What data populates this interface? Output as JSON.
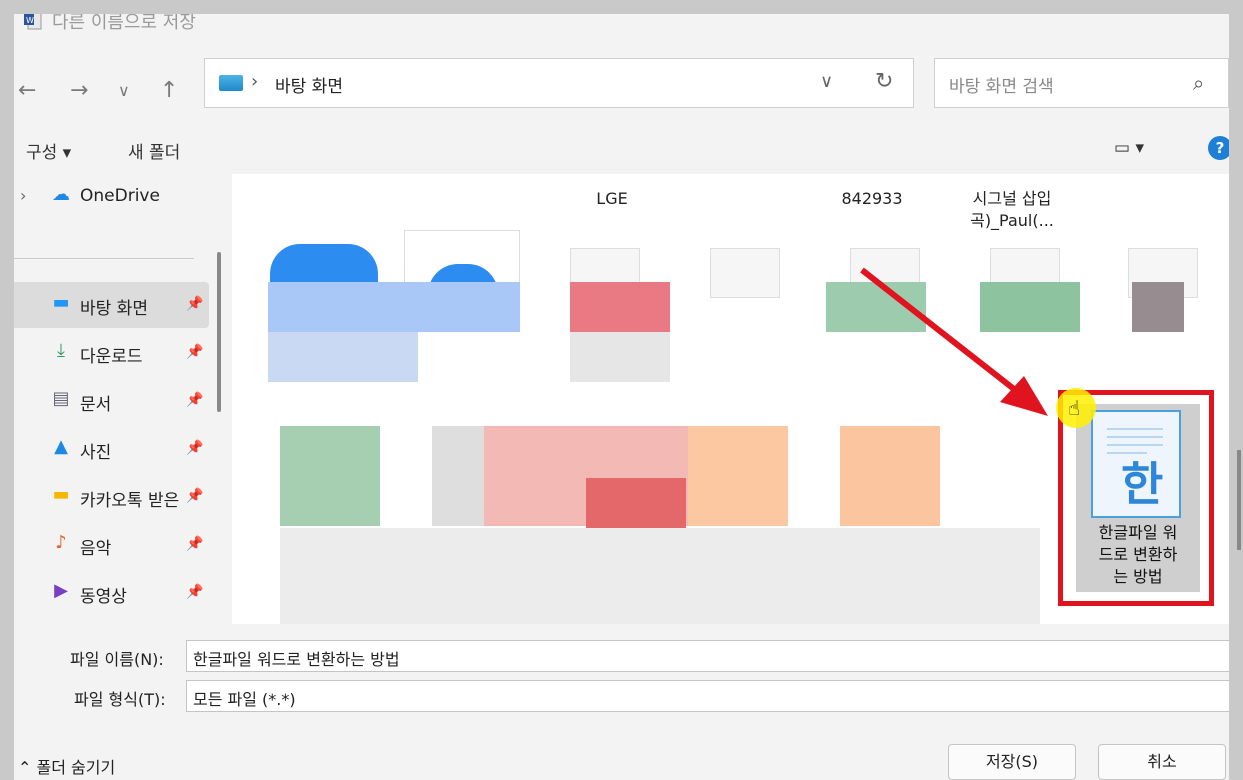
{
  "window": {
    "title": "다른 이름으로 저장",
    "close_icon": "×"
  },
  "nav": {
    "back": "←",
    "forward": "→",
    "recent": "∨",
    "up": "↑",
    "address_sep": "›",
    "address": "바탕 화면",
    "address_dropdown": "∨",
    "refresh": "↻",
    "search_placeholder": "바탕 화면 검색",
    "search_icon": "⌕"
  },
  "toolbar": {
    "organize": "구성 ▾",
    "new_folder": "새 폴더",
    "view": "▭ ▾",
    "help": "?"
  },
  "sidebar": {
    "items": [
      {
        "label": "OneDrive",
        "icon": "☁",
        "chevron": "›"
      },
      {
        "label": "바탕 화면",
        "icon": "▬",
        "pin": "📌"
      },
      {
        "label": "다운로드",
        "icon": "⤓",
        "pin": "📌"
      },
      {
        "label": "문서",
        "icon": "▤",
        "pin": "📌"
      },
      {
        "label": "사진",
        "icon": "▲",
        "pin": "📌"
      },
      {
        "label": "카카오톡 받은",
        "icon": "▬",
        "pin": "📌"
      },
      {
        "label": "음악",
        "icon": "♪",
        "pin": "📌"
      },
      {
        "label": "동영상",
        "icon": "▶",
        "pin": "📌"
      }
    ]
  },
  "files": {
    "top_captions": [
      "LGE",
      "842933",
      "시그널 삽입",
      "곡)_Paul(..."
    ],
    "selected": {
      "name_line1": "한글파일 워",
      "name_line2": "드로 변환하",
      "name_line3": "는 방법",
      "icon_char": "한"
    }
  },
  "bottom": {
    "filename_label": "파일 이름(N):",
    "filename_value": "한글파일 워드로 변환하는 방법",
    "filetype_label": "파일 형식(T):",
    "filetype_value": "모든 파일 (*.*)",
    "dropdown": "∨",
    "hide_folders": "⌃  폴더 숨기기",
    "save": "저장(S)",
    "cancel": "취소"
  },
  "colors": {
    "highlight": "#e0141e",
    "accent": "#1e7fd6",
    "cursor": "#fff000"
  }
}
